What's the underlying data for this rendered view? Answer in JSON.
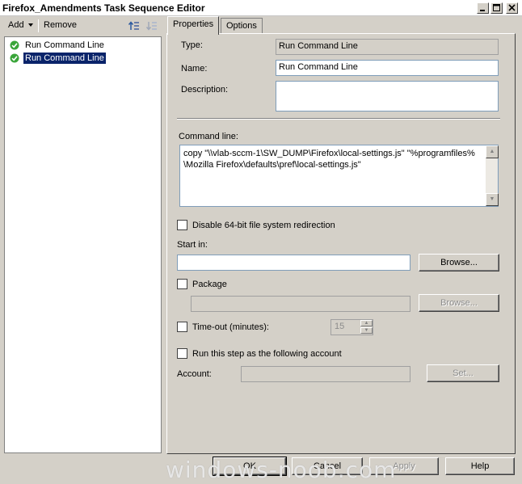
{
  "window": {
    "title": "Firefox_Amendments Task Sequence Editor",
    "controls": {
      "minimize_icon": "minimize-icon",
      "maximize_icon": "maximize-icon",
      "close_icon": "close-icon"
    }
  },
  "toolbar": {
    "add_label": "Add",
    "remove_label": "Remove",
    "move_up_icon": "move-up-icon",
    "move_down_icon": "move-down-icon"
  },
  "tree": {
    "items": [
      {
        "label": "Run Command Line",
        "selected": false,
        "icon": "green-check-icon"
      },
      {
        "label": "Run Command Line",
        "selected": true,
        "icon": "green-check-icon"
      }
    ]
  },
  "tabs": [
    {
      "label": "Properties",
      "active": true
    },
    {
      "label": "Options",
      "active": false
    }
  ],
  "properties": {
    "type_label": "Type:",
    "type_value": "Run Command Line",
    "name_label": "Name:",
    "name_value": "Run Command Line",
    "description_label": "Description:",
    "description_value": "",
    "command_line_label": "Command line:",
    "command_line_value": "copy \"\\\\vlab-sccm-1\\SW_DUMP\\Firefox\\local-settings.js\" \"%programfiles%\\Mozilla Firefox\\defaults\\pref\\local-settings.js\"",
    "disable64_label": "Disable 64-bit file system redirection",
    "disable64_checked": false,
    "start_in_label": "Start in:",
    "start_in_value": "",
    "browse_label": "Browse...",
    "package_label": "Package",
    "package_checked": false,
    "package_value": "",
    "package_browse_label": "Browse...",
    "timeout_label": "Time-out (minutes):",
    "timeout_checked": false,
    "timeout_value": "15",
    "run_as_label": "Run this step as the following account",
    "run_as_checked": false,
    "account_label": "Account:",
    "account_value": "",
    "set_label": "Set..."
  },
  "footer": {
    "ok_label": "OK",
    "cancel_label": "Cancel",
    "apply_label": "Apply",
    "help_label": "Help"
  },
  "watermark": "windows-noob.com"
}
